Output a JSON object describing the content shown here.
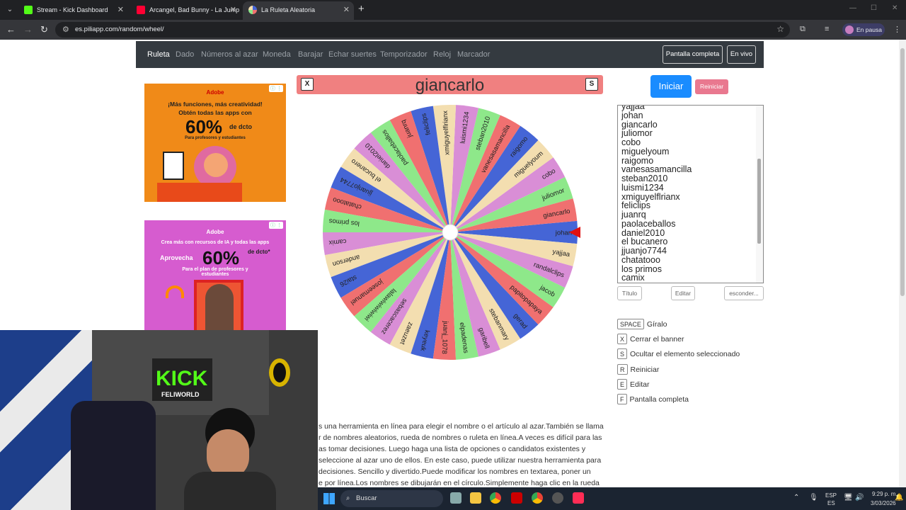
{
  "browser": {
    "tabs": [
      {
        "title": "Stream - Kick Dashboard",
        "active": false
      },
      {
        "title": "Arcangel, Bad Bunny - La Jump",
        "active": false
      },
      {
        "title": "La Ruleta Aleatoria",
        "active": true
      }
    ],
    "url": "es.piliapp.com/random/wheel/",
    "profile_status": "En pausa"
  },
  "site_nav": {
    "links": [
      "Ruleta",
      "Dado",
      "Números al azar",
      "Moneda",
      "Barajar",
      "Echar suertes",
      "Temporizador",
      "Reloj",
      "Marcador"
    ],
    "active": "Ruleta",
    "fullscreen_button": "Pantalla completa",
    "live_button": "En vivo"
  },
  "ads": {
    "ad1": {
      "brand": "Adobe",
      "line1": "¡Más funciones, más creatividad!",
      "line2": "Obtén todas las apps con",
      "pct": "60%",
      "suffix": "de dcto",
      "line3": "Para profesores y estudiantes"
    },
    "ad2": {
      "brand": "Adobe",
      "line1": "Crea más con recursos de IA y todas las apps",
      "lead": "Aprovecha",
      "pct": "60%",
      "suffix": "de dcto*",
      "line3": "Para el plan de profesores y estudiantes"
    }
  },
  "wheel": {
    "selected": "giancarlo",
    "close_key": "X",
    "hide_key": "S",
    "colors": [
      "#4565d6",
      "#f07070",
      "#8ee88a",
      "#d98ed6",
      "#f3deb0"
    ]
  },
  "chart_data": {
    "type": "pie",
    "categories": [
      "johan",
      "giancarlo",
      "juliomor",
      "cobo",
      "miguelyoum",
      "raigomo",
      "vanesasamancilla",
      "steban2010",
      "luismi1234",
      "xmiguyelflrianx",
      "feliclips",
      "juanrq",
      "paolaceballos",
      "daniel2010",
      "el bucanero",
      "jjuanjo7744",
      "chatatooo",
      "los primos",
      "camix",
      "anderson",
      "stai26",
      "joseemanuel",
      "lalawiwiwiwiwi",
      "sebascacerez",
      "zaeuzet",
      "keyeuk",
      "juanj_1078",
      "elpadenas",
      "garibell",
      "stebanmary",
      "gerad",
      "papitopapaya",
      "jacob",
      "randalclips",
      "yajjaa"
    ],
    "values": [
      1,
      1,
      1,
      1,
      1,
      1,
      1,
      1,
      1,
      1,
      1,
      1,
      1,
      1,
      1,
      1,
      1,
      1,
      1,
      1,
      1,
      1,
      1,
      1,
      1,
      1,
      1,
      1,
      1,
      1,
      1,
      1,
      1,
      1,
      1
    ]
  },
  "controls": {
    "start": "Iniciar",
    "reset": "Reiniciar",
    "title_btn": "Título",
    "edit_btn": "Editar",
    "hide_btn": "esconder..."
  },
  "names_list": [
    "yajjaa",
    "johan",
    "giancarlo",
    "juliomor",
    "cobo",
    "miguelyoum",
    "raigomo",
    "vanesasamancilla",
    "steban2010",
    "luismi1234",
    "xmiguyelflrianx",
    "feliclips",
    "juanrq",
    "paolaceballos",
    "daniel2010",
    "el bucanero",
    "jjuanjo7744",
    "chatatooo",
    "los primos",
    "camix",
    "anderson"
  ],
  "shortcuts": [
    {
      "key": "SPACE",
      "label": "Gíralo"
    },
    {
      "key": "X",
      "label": "Cerrar el banner"
    },
    {
      "key": "S",
      "label": "Ocultar el elemento seleccionado"
    },
    {
      "key": "R",
      "label": "Reiniciar"
    },
    {
      "key": "E",
      "label": "Editar"
    },
    {
      "key": "F",
      "label": "Pantalla completa"
    }
  ],
  "description": [
    "s una herramienta en línea para elegir el nombre o el artículo al azar.También se llama",
    "r de nombres aleatorios, rueda de nombres o ruleta en línea.A veces es difícil para las",
    "as tomar decisiones. Luego haga una lista de opciones o candidatos existentes y",
    "seleccione al azar uno de ellos. En este caso, puede utilizar nuestra herramienta para",
    "decisiones. Sencillo y divertido.Puede modificar los nombres en textarea, poner un",
    "e por línea.Los nombres se dibujarán en el círculo.Simplemente haga clic en la rueda"
  ],
  "webcam": {
    "banner": "KICK",
    "sub": "FELIWORLD"
  },
  "taskbar": {
    "search": "Buscar",
    "lang": "ESP",
    "lang2": "ES",
    "time": "9:29 p. m.",
    "date": "3/03/2026"
  }
}
